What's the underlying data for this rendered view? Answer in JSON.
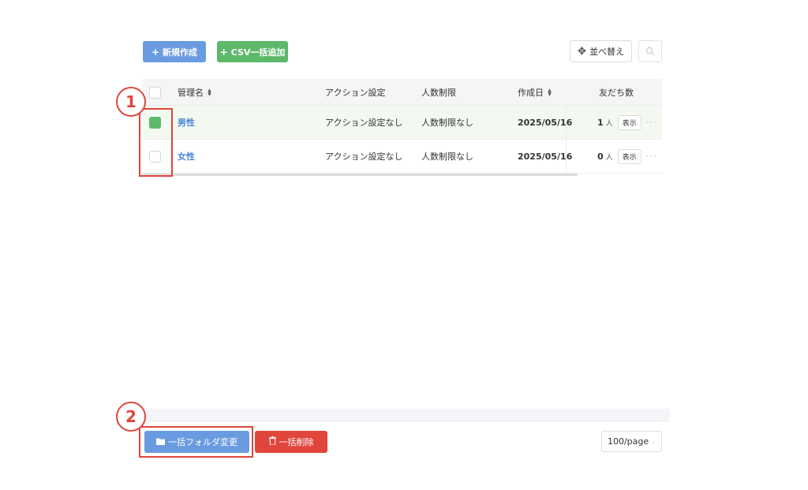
{
  "toolbar": {
    "new_label": "新規作成",
    "csv_label": "CSV一括追加",
    "sort_label": "並べ替え"
  },
  "icons": {
    "plus": "plus-icon",
    "move": "move-arrows-icon",
    "search": "search-icon",
    "sort": "sort-icon",
    "more": "more-dots-icon",
    "folder": "folder-icon",
    "trash": "trash-icon"
  },
  "table": {
    "headers": {
      "name": "管理名",
      "action": "アクション設定",
      "limit": "人数制限",
      "date": "作成日",
      "friends": "友だち数"
    },
    "rows": [
      {
        "name": "男性",
        "action": "アクション設定なし",
        "limit": "人数制限なし",
        "date": "2025/05/16",
        "friends": "1",
        "unit": "人",
        "show": "表示",
        "checked": true
      },
      {
        "name": "女性",
        "action": "アクション設定なし",
        "limit": "人数制限なし",
        "date": "2025/05/16",
        "friends": "0",
        "unit": "人",
        "show": "表示",
        "checked": false
      }
    ]
  },
  "annotations": {
    "one": "1",
    "two": "2"
  },
  "footer": {
    "folder_label": "一括フォルダ変更",
    "delete_label": "一括削除",
    "page_size": "100/page"
  },
  "colors": {
    "primary_blue": "#6a9be0",
    "success_green": "#5cb86a",
    "danger_red": "#e0463b",
    "link_blue": "#4a86d8"
  }
}
